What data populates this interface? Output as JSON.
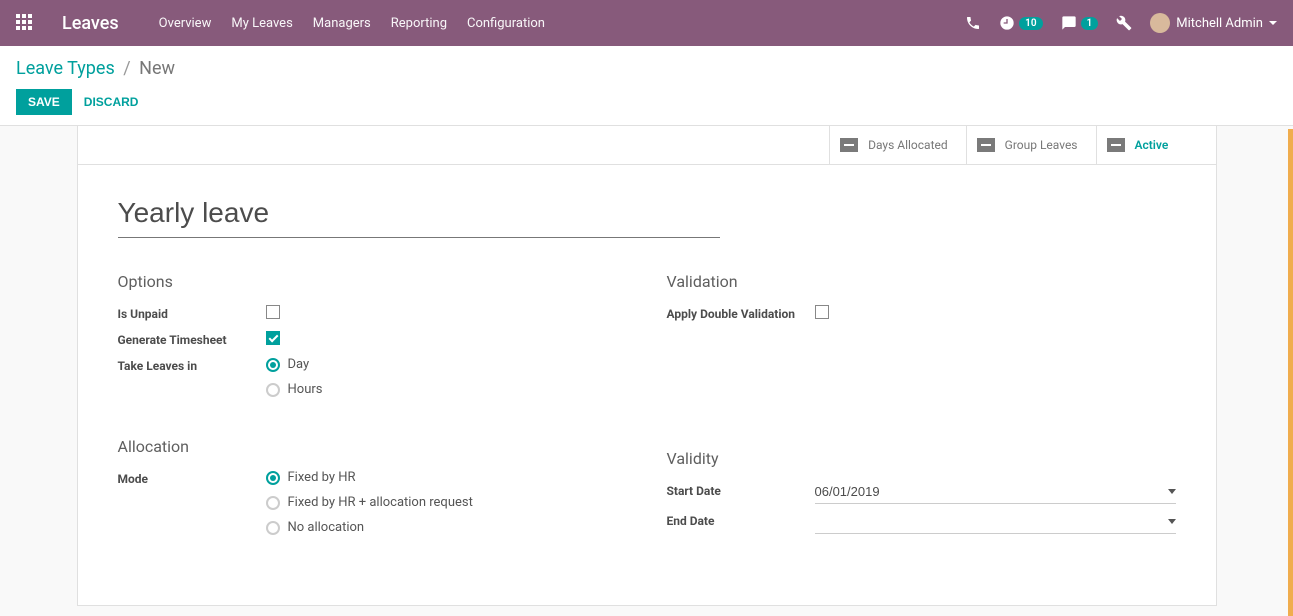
{
  "navbar": {
    "brand": "Leaves",
    "links": [
      "Overview",
      "My Leaves",
      "Managers",
      "Reporting",
      "Configuration"
    ],
    "activities_badge": "10",
    "messages_badge": "1",
    "user_name": "Mitchell Admin"
  },
  "breadcrumb": {
    "parent": "Leave Types",
    "current": "New"
  },
  "buttons": {
    "save": "SAVE",
    "discard": "DISCARD"
  },
  "stat_buttons": {
    "days_allocated": "Days Allocated",
    "group_leaves": "Group Leaves",
    "active": "Active"
  },
  "form": {
    "title_value": "Yearly leave",
    "groups": {
      "options": {
        "title": "Options",
        "is_unpaid_label": "Is Unpaid",
        "is_unpaid_checked": false,
        "generate_timesheet_label": "Generate Timesheet",
        "generate_timesheet_checked": true,
        "take_leaves_label": "Take Leaves in",
        "take_leaves_options": [
          "Day",
          "Hours"
        ],
        "take_leaves_selected": "Day"
      },
      "validation": {
        "title": "Validation",
        "apply_double_label": "Apply Double Validation",
        "apply_double_checked": false
      },
      "allocation": {
        "title": "Allocation",
        "mode_label": "Mode",
        "mode_options": [
          "Fixed by HR",
          "Fixed by HR + allocation request",
          "No allocation"
        ],
        "mode_selected": "Fixed by HR"
      },
      "validity": {
        "title": "Validity",
        "start_date_label": "Start Date",
        "start_date_value": "06/01/2019",
        "end_date_label": "End Date",
        "end_date_value": ""
      }
    }
  }
}
